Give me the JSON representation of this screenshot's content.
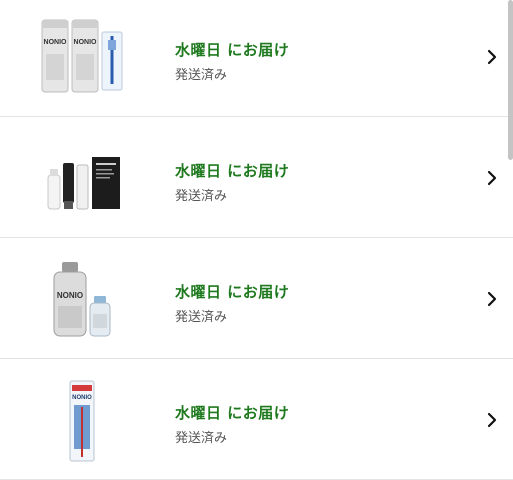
{
  "orders": [
    {
      "product_image": "toothpaste-set-thumbnail",
      "brand_text": "NONIO",
      "delivery": "水曜日  にお届け",
      "status": "発送済み"
    },
    {
      "product_image": "skincare-set-thumbnail",
      "delivery": "水曜日  にお届け",
      "status": "発送済み"
    },
    {
      "product_image": "mouthwash-bottles-thumbnail",
      "brand_text": "NONIO",
      "delivery": "水曜日  にお届け",
      "status": "発送済み"
    },
    {
      "product_image": "toothbrush-pack-thumbnail",
      "brand_text": "NONIO",
      "delivery": "水曜日  にお届け",
      "status": "発送済み"
    }
  ],
  "colors": {
    "delivery_text": "#1f7a1f",
    "status_text": "#555555",
    "divider": "#e3e3e3"
  },
  "icons": {
    "row_action": "chevron-right-icon"
  }
}
